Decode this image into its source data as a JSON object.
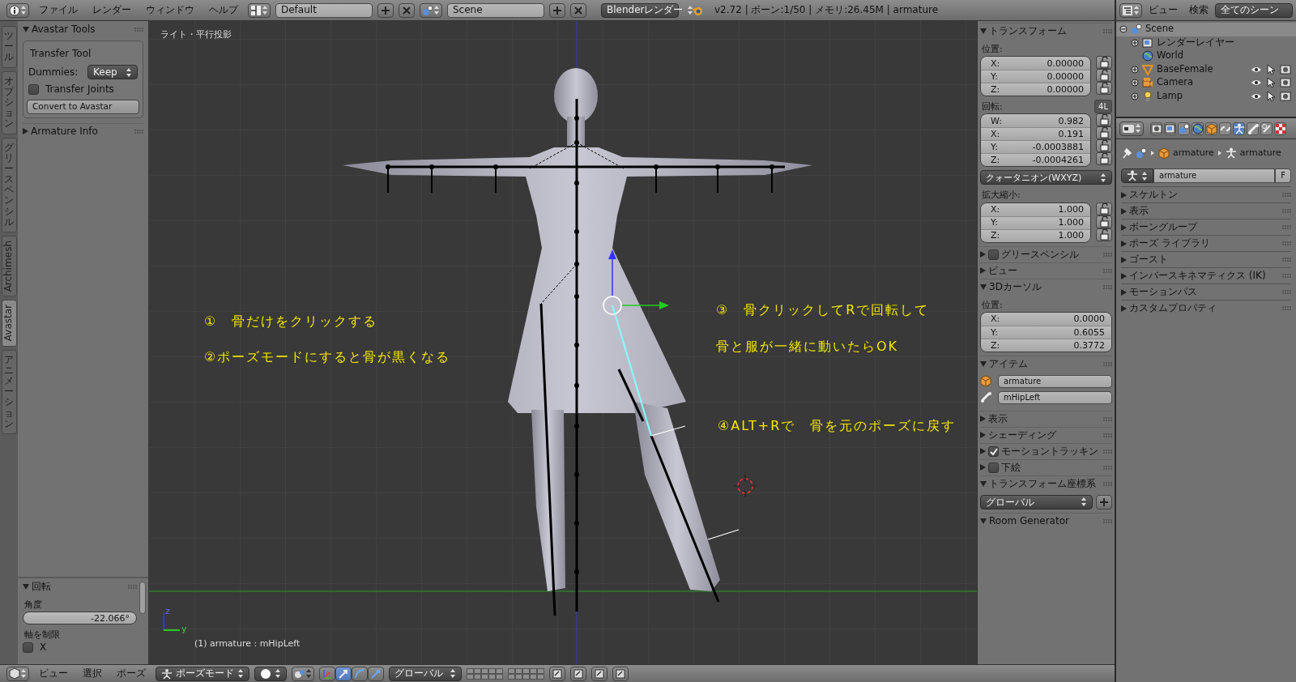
{
  "header": {
    "menus": [
      "ファイル",
      "レンダー",
      "ウィンドウ",
      "ヘルプ"
    ],
    "layout": "Default",
    "scene": "Scene",
    "engine": "Blenderレンダー",
    "stats": "v2.72 | ボーン:1/50 | メモリ:26.45M | armature"
  },
  "tool_tabs": [
    {
      "label": "ツール",
      "kind": "cjk",
      "selected": false
    },
    {
      "label": "オプション",
      "kind": "cjk",
      "selected": false
    },
    {
      "label": "グリースペンシル",
      "kind": "cjk",
      "selected": false
    },
    {
      "label": "Archimesh",
      "kind": "latin",
      "selected": false
    },
    {
      "label": "Avastar",
      "kind": "latin",
      "selected": true
    },
    {
      "label": "アニメーション",
      "kind": "cjk",
      "selected": false
    }
  ],
  "tool_panels": [
    {
      "title": "Avastar Tools",
      "expanded": true,
      "box_title": "Transfer Tool",
      "dummies_label": "Dummies:",
      "dummies_value": "Keep",
      "checkbox": {
        "label": "Transfer Joints",
        "checked": false
      },
      "button": "Convert to Avastar"
    },
    {
      "title": "Armature Info",
      "expanded": false
    }
  ],
  "operator_panel": {
    "title": "回転",
    "expanded": true,
    "angle_label": "角度",
    "angle_value": "-22.066°",
    "constraint_label": "軸を制限",
    "axes": [
      {
        "label": "X",
        "checked": false
      }
    ]
  },
  "viewport": {
    "view_label": "ライト・平行投影",
    "object_label": "(1) armature : mHipLeft",
    "axis_labels": [
      "z",
      "y"
    ],
    "annotations": [
      "①　骨だけをクリックする",
      "②ポーズモードにすると骨が黒くなる",
      "③　骨クリックしてRで回転して",
      "骨と服が一緒に動いたらOK",
      "④ALT+Rで　骨を元のポーズに戻す"
    ]
  },
  "n_panel": {
    "sections": [
      {
        "kind": "transform",
        "title": "トランスフォーム",
        "expanded": true,
        "location_label": "位置:",
        "location": [
          {
            "axis": "X:",
            "value": "0.00000"
          },
          {
            "axis": "Y:",
            "value": "0.00000"
          },
          {
            "axis": "Z:",
            "value": "0.00000"
          }
        ],
        "rotation_label": "回転:",
        "rotation": [
          {
            "axis": "W:",
            "value": "0.982"
          },
          {
            "axis": "X:",
            "value": "0.191"
          },
          {
            "axis": "Y:",
            "value": "-0.0003881"
          },
          {
            "axis": "Z:",
            "value": "-0.0004261"
          }
        ],
        "four_l": "4L",
        "rotation_mode": "クォータニオン(WXYZ)",
        "scale_label": "拡大縮小:",
        "scale": [
          {
            "axis": "X:",
            "value": "1.000"
          },
          {
            "axis": "Y:",
            "value": "1.000"
          },
          {
            "axis": "Z:",
            "value": "1.000"
          }
        ]
      },
      {
        "kind": "toggle",
        "title": "グリースペンシル",
        "expanded": false,
        "checked": false
      },
      {
        "kind": "plain",
        "title": "ビュー",
        "expanded": false
      },
      {
        "kind": "cursor",
        "title": "3Dカーソル",
        "expanded": true,
        "location_label": "位置:",
        "location": [
          {
            "axis": "X:",
            "value": "0.0000"
          },
          {
            "axis": "Y:",
            "value": "0.6055"
          },
          {
            "axis": "Z:",
            "value": "0.3772"
          }
        ]
      },
      {
        "kind": "item",
        "title": "アイテム",
        "expanded": true,
        "object_name": "armature",
        "bone_name": "mHipLeft"
      },
      {
        "kind": "plain",
        "title": "表示",
        "expanded": false
      },
      {
        "kind": "plain",
        "title": "シェーディング",
        "expanded": false
      },
      {
        "kind": "toggle",
        "title": "モーショントラッキン",
        "expanded": false,
        "checked": true
      },
      {
        "kind": "toggle",
        "title": "下絵",
        "expanded": false,
        "checked": false
      },
      {
        "kind": "orientation",
        "title": "トランスフォーム座標系",
        "expanded": true,
        "value": "グローバル"
      },
      {
        "kind": "plain",
        "title": "Room Generator",
        "expanded": true
      }
    ]
  },
  "outliner": {
    "menus": [
      "ビュー",
      "検索"
    ],
    "filter": "全てのシーン",
    "items": [
      {
        "label": "Scene",
        "kind": "scene",
        "selected": true,
        "expanded": true,
        "children": [
          {
            "label": "レンダーレイヤー",
            "kind": "renderlayer",
            "selected": false,
            "expanded": false
          },
          {
            "label": "World",
            "kind": "world",
            "selected": false
          },
          {
            "label": "BaseFemale",
            "kind": "mesh",
            "selected": false,
            "expanded": false
          },
          {
            "label": "Camera",
            "kind": "camera",
            "selected": false,
            "expanded": false
          },
          {
            "label": "Lamp",
            "kind": "lamp",
            "selected": false,
            "expanded": false
          }
        ]
      }
    ]
  },
  "properties": {
    "tabs": [
      {
        "kind": "render",
        "selected": false
      },
      {
        "kind": "renderlayer",
        "selected": false
      },
      {
        "kind": "scene",
        "selected": false
      },
      {
        "kind": "world",
        "selected": false
      },
      {
        "kind": "object",
        "selected": false
      },
      {
        "kind": "constraint",
        "selected": false
      },
      {
        "kind": "armature",
        "selected": true
      },
      {
        "kind": "bone",
        "selected": false
      },
      {
        "kind": "boneconstraint",
        "selected": false
      },
      {
        "kind": "texture",
        "selected": false
      }
    ],
    "breadcrumbs": [
      "armature",
      "armature"
    ],
    "datablock": "armature",
    "fake_user": "F",
    "panels": [
      {
        "title": "スケルトン",
        "expanded": false
      },
      {
        "title": "表示",
        "expanded": false
      },
      {
        "title": "ボーングループ",
        "expanded": false
      },
      {
        "title": "ポーズ ライブラリ",
        "expanded": false
      },
      {
        "title": "ゴースト",
        "expanded": false
      },
      {
        "title": "インバースキネマティクス (IK)",
        "expanded": false
      },
      {
        "title": "モーションパス",
        "expanded": false
      },
      {
        "title": "カスタムプロパティ",
        "expanded": false
      }
    ]
  },
  "bottom_bar": {
    "menus": [
      "ビュー",
      "選択",
      "ポーズ"
    ],
    "mode": "ポーズモード",
    "orientation": "グローバル",
    "manipulators": [
      {
        "kind": "toggle",
        "selected": false
      },
      {
        "kind": "translate",
        "selected": true
      },
      {
        "kind": "rotate",
        "selected": false
      },
      {
        "kind": "scale",
        "selected": false
      }
    ]
  }
}
